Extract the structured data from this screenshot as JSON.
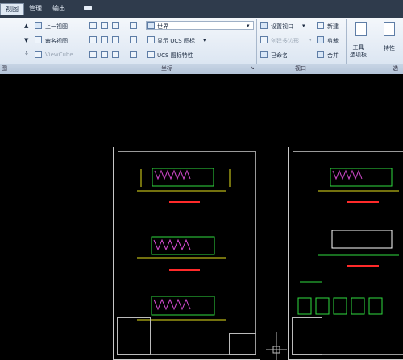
{
  "tabs": [
    "视图",
    "管理",
    "输出"
  ],
  "views": {
    "items": [
      "上一视图",
      "命名视图",
      "ViewCube"
    ]
  },
  "coords": {
    "world": "世界",
    "show_ucs": "显示 UCS 图标",
    "ucs_props": "UCS 图标特性",
    "panel_label": "坐标"
  },
  "viewports": {
    "set_viewport": "设置视口",
    "create_poly": "创建多边形",
    "named": "已命名",
    "new": "新建",
    "clip": "剪裁",
    "merge": "合并",
    "panel_label": "视口"
  },
  "tools": {
    "palettes": "工具\n选项板",
    "properties": "特性",
    "panel_label_right": "选"
  },
  "colors": {
    "drawing_green": "#2fdc3f",
    "drawing_yellow": "#e6e21c",
    "drawing_magenta": "#d64cd2",
    "red_mark": "#ff2a2a"
  }
}
